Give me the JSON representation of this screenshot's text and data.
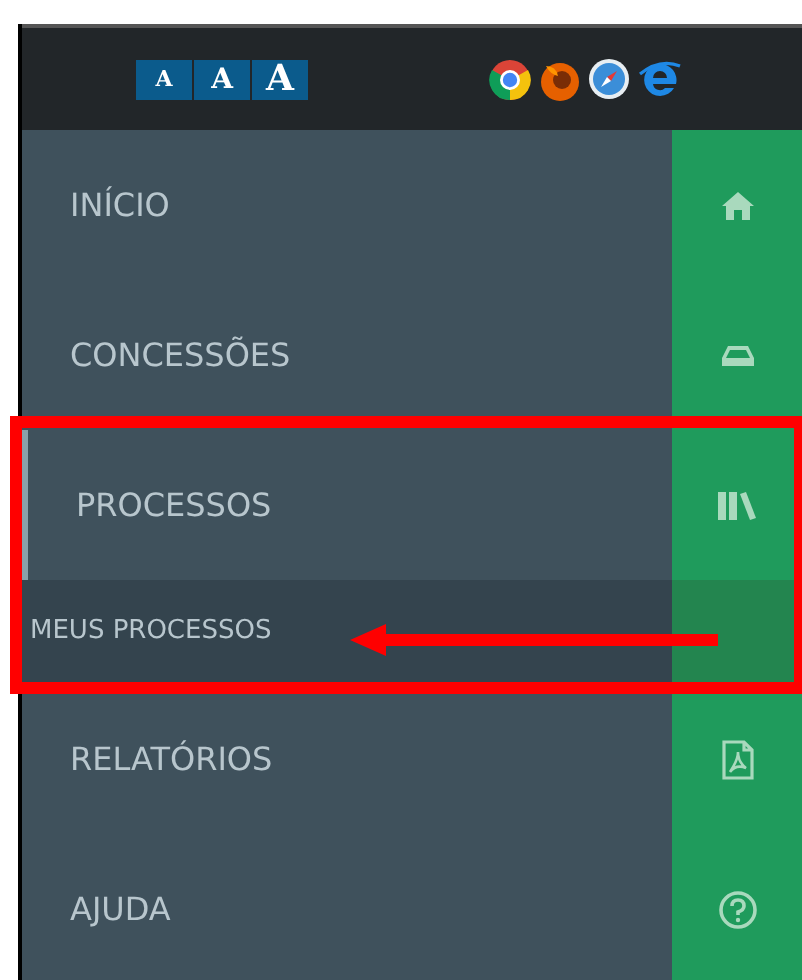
{
  "font_size_buttons": [
    "A",
    "A",
    "A"
  ],
  "menu": [
    {
      "label": "INÍCIO",
      "expanded": false
    },
    {
      "label": "CONCESSÕES",
      "expanded": false
    },
    {
      "label": "PROCESSOS",
      "expanded": true,
      "children": [
        {
          "label": "MEUS PROCESSOS"
        }
      ]
    },
    {
      "label": "RELATÓRIOS",
      "expanded": false
    },
    {
      "label": "AJUDA",
      "expanded": false
    }
  ]
}
